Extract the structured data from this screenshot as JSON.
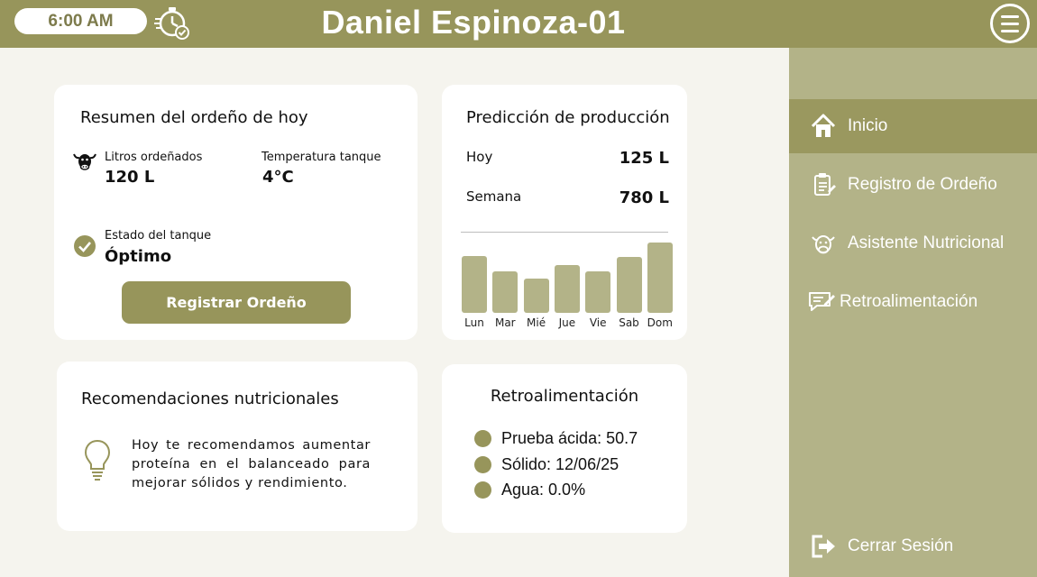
{
  "header": {
    "time": "6:00 AM",
    "title": "Daniel Espinoza-01"
  },
  "sidebar": {
    "items": [
      {
        "label": "Inicio",
        "icon": "home-icon"
      },
      {
        "label": "Registro de Ordeño",
        "icon": "clipboard-icon"
      },
      {
        "label": "Asistente Nutricional",
        "icon": "cow-icon"
      },
      {
        "label": "Retroalimentación",
        "icon": "feedback-icon"
      }
    ],
    "logout": "Cerrar Sesión"
  },
  "summary": {
    "title": "Resumen del ordeño de hoy",
    "liters_label": "Litros ordeñados",
    "liters_value": "120 L",
    "temp_label": "Temperatura tanque",
    "temp_value": "4°C",
    "status_label": "Estado del tanque",
    "status_value": "Óptimo",
    "button": "Registrar Ordeño"
  },
  "prediction": {
    "title": "Predicción de producción",
    "today_label": "Hoy",
    "today_value": "125 L",
    "week_label": "Semana",
    "week_value": "780 L"
  },
  "chart_data": {
    "type": "bar",
    "categories": [
      "Lun",
      "Mar",
      "Mié",
      "Jue",
      "Vie",
      "Sab",
      "Dom"
    ],
    "values": [
      63,
      46,
      38,
      53,
      46,
      62,
      78
    ]
  },
  "recommendations": {
    "title": "Recomendaciones nutricionales",
    "text": "Hoy te recomendamos aumentar proteína en el balanceado para mejorar sólidos y rendimiento."
  },
  "feedback": {
    "title": "Retroalimentación",
    "items": [
      "Prueba ácida: 50.7",
      "Sólido: 12/06/25",
      "Agua: 0.0%"
    ]
  },
  "colors": {
    "primary": "#97955b",
    "sidebar": "#b3b388",
    "background": "#f5f4ee"
  }
}
